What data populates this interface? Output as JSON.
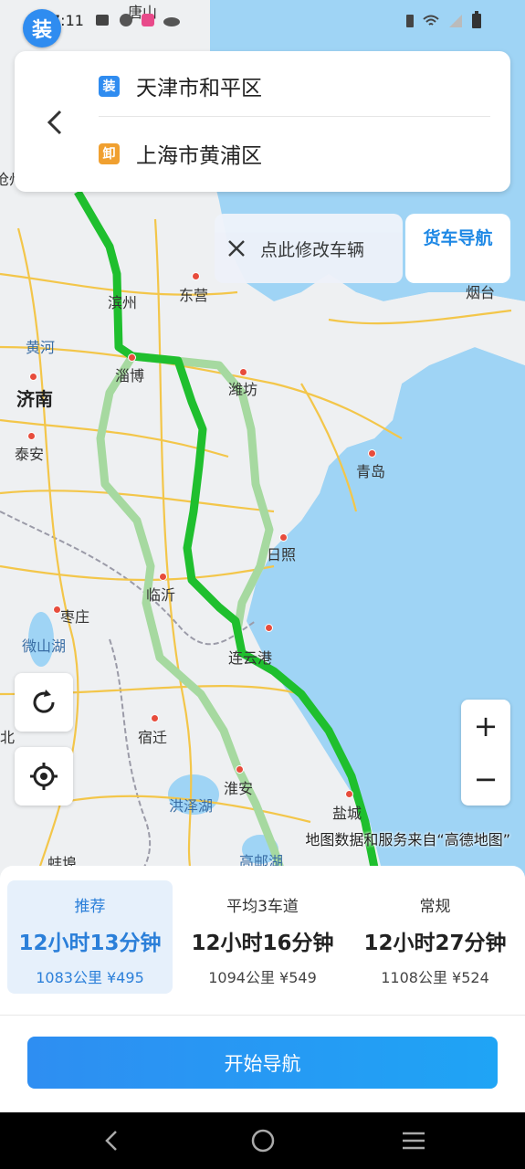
{
  "status_bar": {
    "time": "7:11",
    "app_badge": "装"
  },
  "map": {
    "cities": [
      {
        "name": "滨州"
      },
      {
        "name": "东营"
      },
      {
        "name": "烟台"
      },
      {
        "name": "黄河"
      },
      {
        "name": "淄博"
      },
      {
        "name": "济南"
      },
      {
        "name": "潍坊"
      },
      {
        "name": "泰安"
      },
      {
        "name": "青岛"
      },
      {
        "name": "日照"
      },
      {
        "name": "临沂"
      },
      {
        "name": "枣庄"
      },
      {
        "name": "微山湖"
      },
      {
        "name": "连云港"
      },
      {
        "name": "宿迁"
      },
      {
        "name": "淮安"
      },
      {
        "name": "洪泽湖"
      },
      {
        "name": "盐城"
      },
      {
        "name": "高邮湖"
      },
      {
        "name": "蚌埠"
      },
      {
        "name": "北"
      },
      {
        "name": "唐山"
      },
      {
        "name": "沧州"
      }
    ],
    "attribution": "地图数据和服务来自“高德地图”"
  },
  "address": {
    "load_tag": "装",
    "origin": "天津市和平区",
    "unload_tag": "卸",
    "destination": "上海市黄浦区",
    "load_color": "#2f8cf0",
    "unload_color": "#f0a030"
  },
  "vehicle_prompt": "点此修改车辆",
  "truck_nav_label": "货车导航",
  "zoom": {
    "in": "+",
    "out": "−"
  },
  "routes": [
    {
      "name": "推荐",
      "duration": "12小时13分钟",
      "meta": "1083公里  ¥495",
      "selected": true
    },
    {
      "name": "平均3车道",
      "duration": "12小时16分钟",
      "meta": "1094公里  ¥549",
      "selected": false
    },
    {
      "name": "常规",
      "duration": "12小时27分钟",
      "meta": "1108公里  ¥524",
      "selected": false
    }
  ],
  "start_button": "开始导航",
  "icons": [
    "back-icon",
    "close-icon",
    "refresh-icon",
    "locate-icon",
    "nav-back-icon",
    "nav-home-icon",
    "nav-menu-icon"
  ],
  "colors": {
    "accent": "#1e88e5",
    "route_main": "#1fbf2e",
    "route_alt": "#a6d9a0"
  }
}
